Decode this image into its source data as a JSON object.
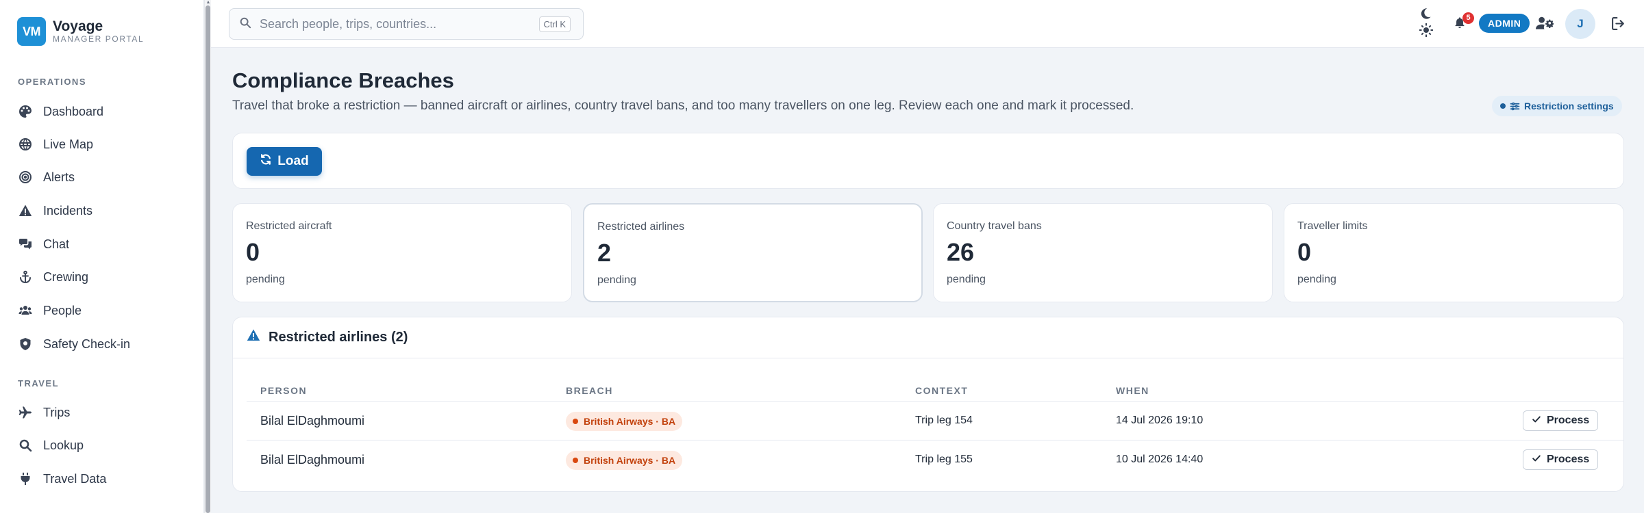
{
  "brand": {
    "logo": "VM",
    "name": "Voyage",
    "subtitle": "MANAGER PORTAL"
  },
  "sidebar": {
    "sections": [
      {
        "label": "OPERATIONS",
        "items": [
          {
            "label": "Dashboard",
            "icon": "palette-icon"
          },
          {
            "label": "Live Map",
            "icon": "globe-icon"
          },
          {
            "label": "Alerts",
            "icon": "target-icon"
          },
          {
            "label": "Incidents",
            "icon": "warning-icon"
          },
          {
            "label": "Chat",
            "icon": "chat-icon"
          },
          {
            "label": "Crewing",
            "icon": "anchor-icon"
          },
          {
            "label": "People",
            "icon": "people-icon"
          },
          {
            "label": "Safety Check-in",
            "icon": "shield-icon"
          }
        ]
      },
      {
        "label": "TRAVEL",
        "items": [
          {
            "label": "Trips",
            "icon": "plane-icon"
          },
          {
            "label": "Lookup",
            "icon": "search-icon"
          },
          {
            "label": "Travel Data",
            "icon": "plug-icon"
          }
        ]
      }
    ]
  },
  "topbar": {
    "search_placeholder": "Search people, trips, countries...",
    "search_shortcut": "Ctrl K",
    "notifications_count": "5",
    "role_badge": "ADMIN",
    "avatar_initial": "J"
  },
  "page": {
    "title": "Compliance Breaches",
    "description": "Travel that broke a restriction — banned aircraft or airlines, country travel bans, and too many travellers on one leg. Review each one and mark it processed.",
    "restriction_settings_label": "Restriction settings",
    "load_label": "Load"
  },
  "stats": [
    {
      "label": "Restricted aircraft",
      "value": "0",
      "sub": "pending"
    },
    {
      "label": "Restricted airlines",
      "value": "2",
      "sub": "pending"
    },
    {
      "label": "Country travel bans",
      "value": "26",
      "sub": "pending"
    },
    {
      "label": "Traveller limits",
      "value": "0",
      "sub": "pending"
    }
  ],
  "table": {
    "title": "Restricted airlines (2)",
    "columns": [
      "PERSON",
      "BREACH",
      "CONTEXT",
      "WHEN"
    ],
    "action_label": "Process",
    "rows": [
      {
        "person": "Bilal ElDaghmoumi",
        "breach": "British Airways · BA",
        "context": "Trip leg 154",
        "when": "14 Jul 2026 19:10"
      },
      {
        "person": "Bilal ElDaghmoumi",
        "breach": "British Airways · BA",
        "context": "Trip leg 155",
        "when": "10 Jul 2026 14:40"
      }
    ]
  },
  "colors": {
    "accent": "#1567b0",
    "admin_badge": "#1279c4",
    "breach_text": "#c2410c",
    "breach_bg": "#fde9e0",
    "notification": "#e03131"
  }
}
